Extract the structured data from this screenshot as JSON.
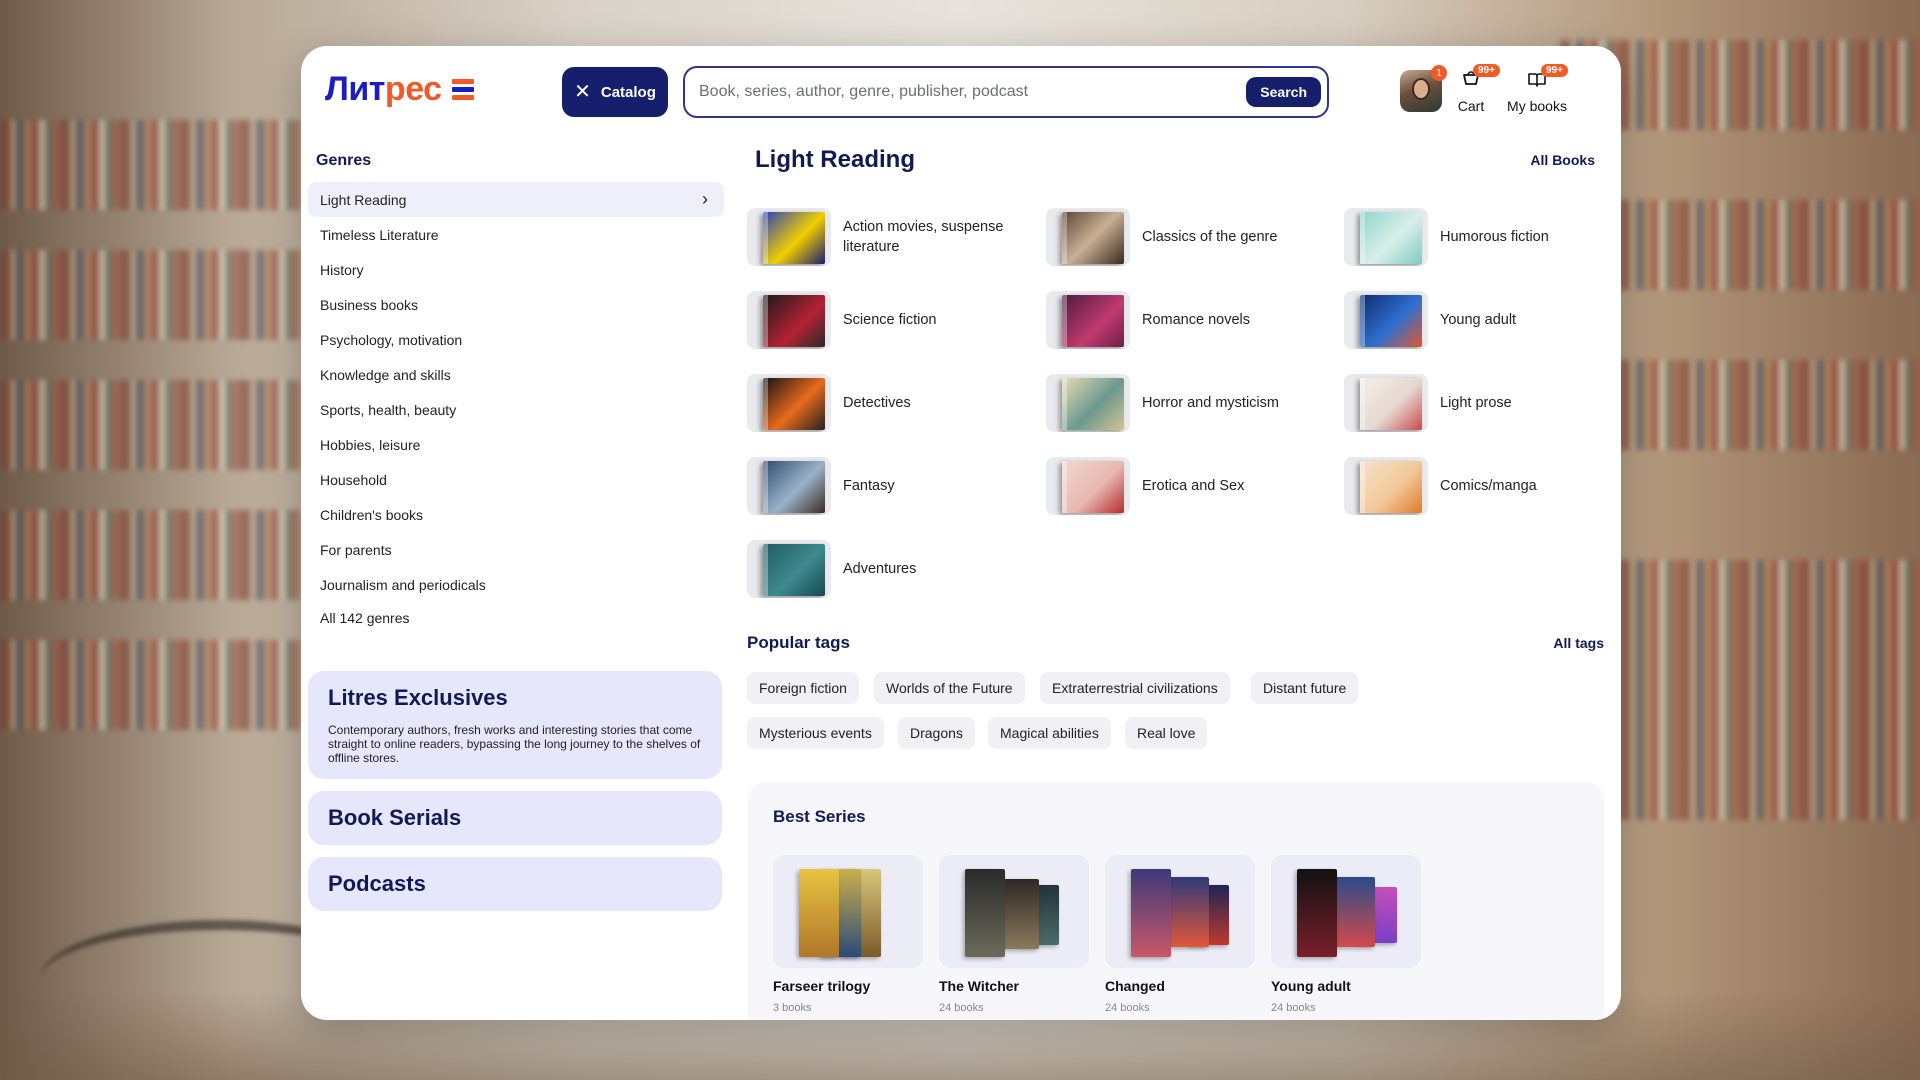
{
  "header": {
    "logo_text_main": "Лит",
    "logo_text_accent": "рес",
    "catalog_label": "Catalog",
    "search_placeholder": "Book, series, author, genre, publisher, podcast",
    "search_button": "Search",
    "avatar_badge": "1",
    "cart_label": "Cart",
    "cart_badge": "99+",
    "mybooks_label": "My books",
    "mybooks_badge": "99+"
  },
  "sidebar": {
    "title": "Genres",
    "items": [
      "Light Reading",
      "Timeless Literature",
      "History",
      "Business books",
      "Psychology, motivation",
      "Knowledge and skills",
      "Sports, health, beauty",
      "Hobbies, leisure",
      "Household",
      "Children's books",
      "For parents",
      "Journalism and periodicals"
    ],
    "all_genres": "All 142 genres"
  },
  "promos": [
    {
      "title": "Litres Exclusives",
      "desc": "Contemporary authors, fresh works and interesting stories that come straight to online readers, bypassing the long journey to the shelves of offline stores."
    },
    {
      "title": "Book Serials"
    },
    {
      "title": "Podcasts"
    }
  ],
  "main": {
    "title": "Light Reading",
    "all_books": "All Books",
    "subgenres": [
      "Action movies, suspense literature",
      "Classics of the genre",
      "Humorous fiction",
      "Science fiction",
      "Romance novels",
      "Young adult",
      "Detectives",
      "Horror and mysticism",
      "Light prose",
      "Fantasy",
      "Erotica and Sex",
      "Comics/manga",
      "Adventures"
    ]
  },
  "tags": {
    "title": "Popular tags",
    "all_tags": "All tags",
    "items": [
      "Foreign fiction",
      "Worlds of the Future",
      "Extraterrestrial civilizations",
      "Distant future",
      "Mysterious events",
      "Dragons",
      "Magical abilities",
      "Real love"
    ]
  },
  "best_series": {
    "title": "Best Series",
    "items": [
      {
        "name": "Farseer trilogy",
        "count": "3 books"
      },
      {
        "name": "The Witcher",
        "count": "24 books"
      },
      {
        "name": "Changed",
        "count": "24 books"
      },
      {
        "name": "Young adult",
        "count": "24 books"
      }
    ]
  },
  "colors": {
    "brand_blue": "#1a1dbf",
    "brand_orange": "#f05a28",
    "dark_navy": "#151f6b",
    "logo_bar_1": "#f05a28",
    "logo_bar_2": "#1a1dbf",
    "logo_bar_3": "#f05a28"
  },
  "icons": {
    "catalog": "close-icon",
    "cart": "cart-icon",
    "mybooks": "open-book-icon",
    "genre_chevron": "chevron-right-icon"
  }
}
